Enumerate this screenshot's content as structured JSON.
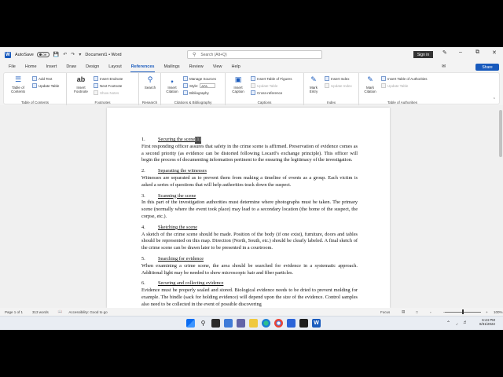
{
  "titlebar": {
    "autosave_label": "AutoSave",
    "autosave_state": "Off",
    "doc_title": "Document1 • Word",
    "search_placeholder": "Search (Alt+Q)",
    "signin_label": "Sign in"
  },
  "menu": {
    "tabs": [
      "File",
      "Home",
      "Insert",
      "Draw",
      "Design",
      "Layout",
      "References",
      "Mailings",
      "Review",
      "View",
      "Help"
    ],
    "active": "References",
    "share_label": "Share"
  },
  "ribbon": {
    "toc": {
      "big": "Table of Contents",
      "add_text": "Add Text",
      "update_table": "Update Table",
      "label": "Table of Contents"
    },
    "footnotes": {
      "insert_footnote": "Insert Footnote",
      "insert_endnote": "Insert Endnote",
      "next_footnote": "Next Footnote",
      "show_notes": "Show Notes",
      "label": "Footnotes"
    },
    "research": {
      "search": "Search",
      "label": "Research"
    },
    "citations": {
      "insert_citation": "Insert Citation",
      "manage_sources": "Manage Sources",
      "style_label": "Style:",
      "style_value": "APA",
      "bibliography": "Bibliography",
      "label": "Citations & Bibliography"
    },
    "captions": {
      "insert_caption": "Insert Caption",
      "insert_table_of_figures": "Insert Table of Figures",
      "update_table": "Update Table",
      "cross_reference": "Cross-reference",
      "label": "Captions"
    },
    "index": {
      "mark_entry": "Mark Entry",
      "insert_index": "Insert Index",
      "update_index": "Update Index",
      "label": "Index"
    },
    "toa": {
      "mark_citation": "Mark Citation",
      "insert_toa": "Insert Table of Authorities",
      "update_table": "Update Table",
      "label": "Table of Authorities"
    }
  },
  "document": {
    "sections": [
      {
        "num": "1.",
        "title": "Securing the scene",
        "title_selected": "[1]",
        "body": "First responding officer assures that safety in the crime scene is affirmed. Preservation of evidence comes as a second priority (as evidence can be distorted following Locard’s exchange principle). This officer will begin the process of documenting information pertinent to the ensuring the legitimacy of the investigation."
      },
      {
        "num": "2.",
        "title": "Separating the witnesses",
        "title_selected": "",
        "body": "Witnesses are separated as to prevent them from making a timeline of events as a group. Each victim is asked a series of questions that will help authorities track down the suspect."
      },
      {
        "num": "3.",
        "title": "Scanning the scene",
        "title_selected": "",
        "body": "In this part of the investigation authorities must determine where photographs must be taken. The primary scene (normally where the event took place) may lead to a secondary location (the home of the suspect, the corpse, etc.)."
      },
      {
        "num": "4.",
        "title": "Sketching the scene",
        "title_selected": "",
        "body": "A sketch of the crime scene should be made. Position of the body (if one exist), furniture, doors and tables should be represented on this map. Direction (North, South, etc.) should be clearly labeled. A final sketch of the crime scene can be drawn later to be presented in a courtroom."
      },
      {
        "num": "5.",
        "title": "Searching for evidence",
        "title_selected": "",
        "body": "When examining a crime scene, the area should be searched for evidence in a systematic approach. Additional light may be needed to show microscopic hair and fiber particles."
      },
      {
        "num": "6.",
        "title": "Securing and collecting evidence",
        "title_selected": "",
        "body": "Evidence must be properly sealed and stored. Biological evidence needs to be dried to prevent molding for example. The bindle (sack for holding evidence) will depend upon the size of the evidence. Control samples also need to be collected in the event of possible discovering"
      }
    ]
  },
  "statusbar": {
    "page": "Page 1 of 1",
    "words": "313 words",
    "accessibility": "Accessibility: Good to go",
    "focus": "Focus",
    "zoom": "100%"
  },
  "taskbar": {
    "time": "6:44 PM",
    "date": "8/31/2022"
  },
  "colors": {
    "accent": "#185abd",
    "taskbar": "#e9edf3"
  }
}
